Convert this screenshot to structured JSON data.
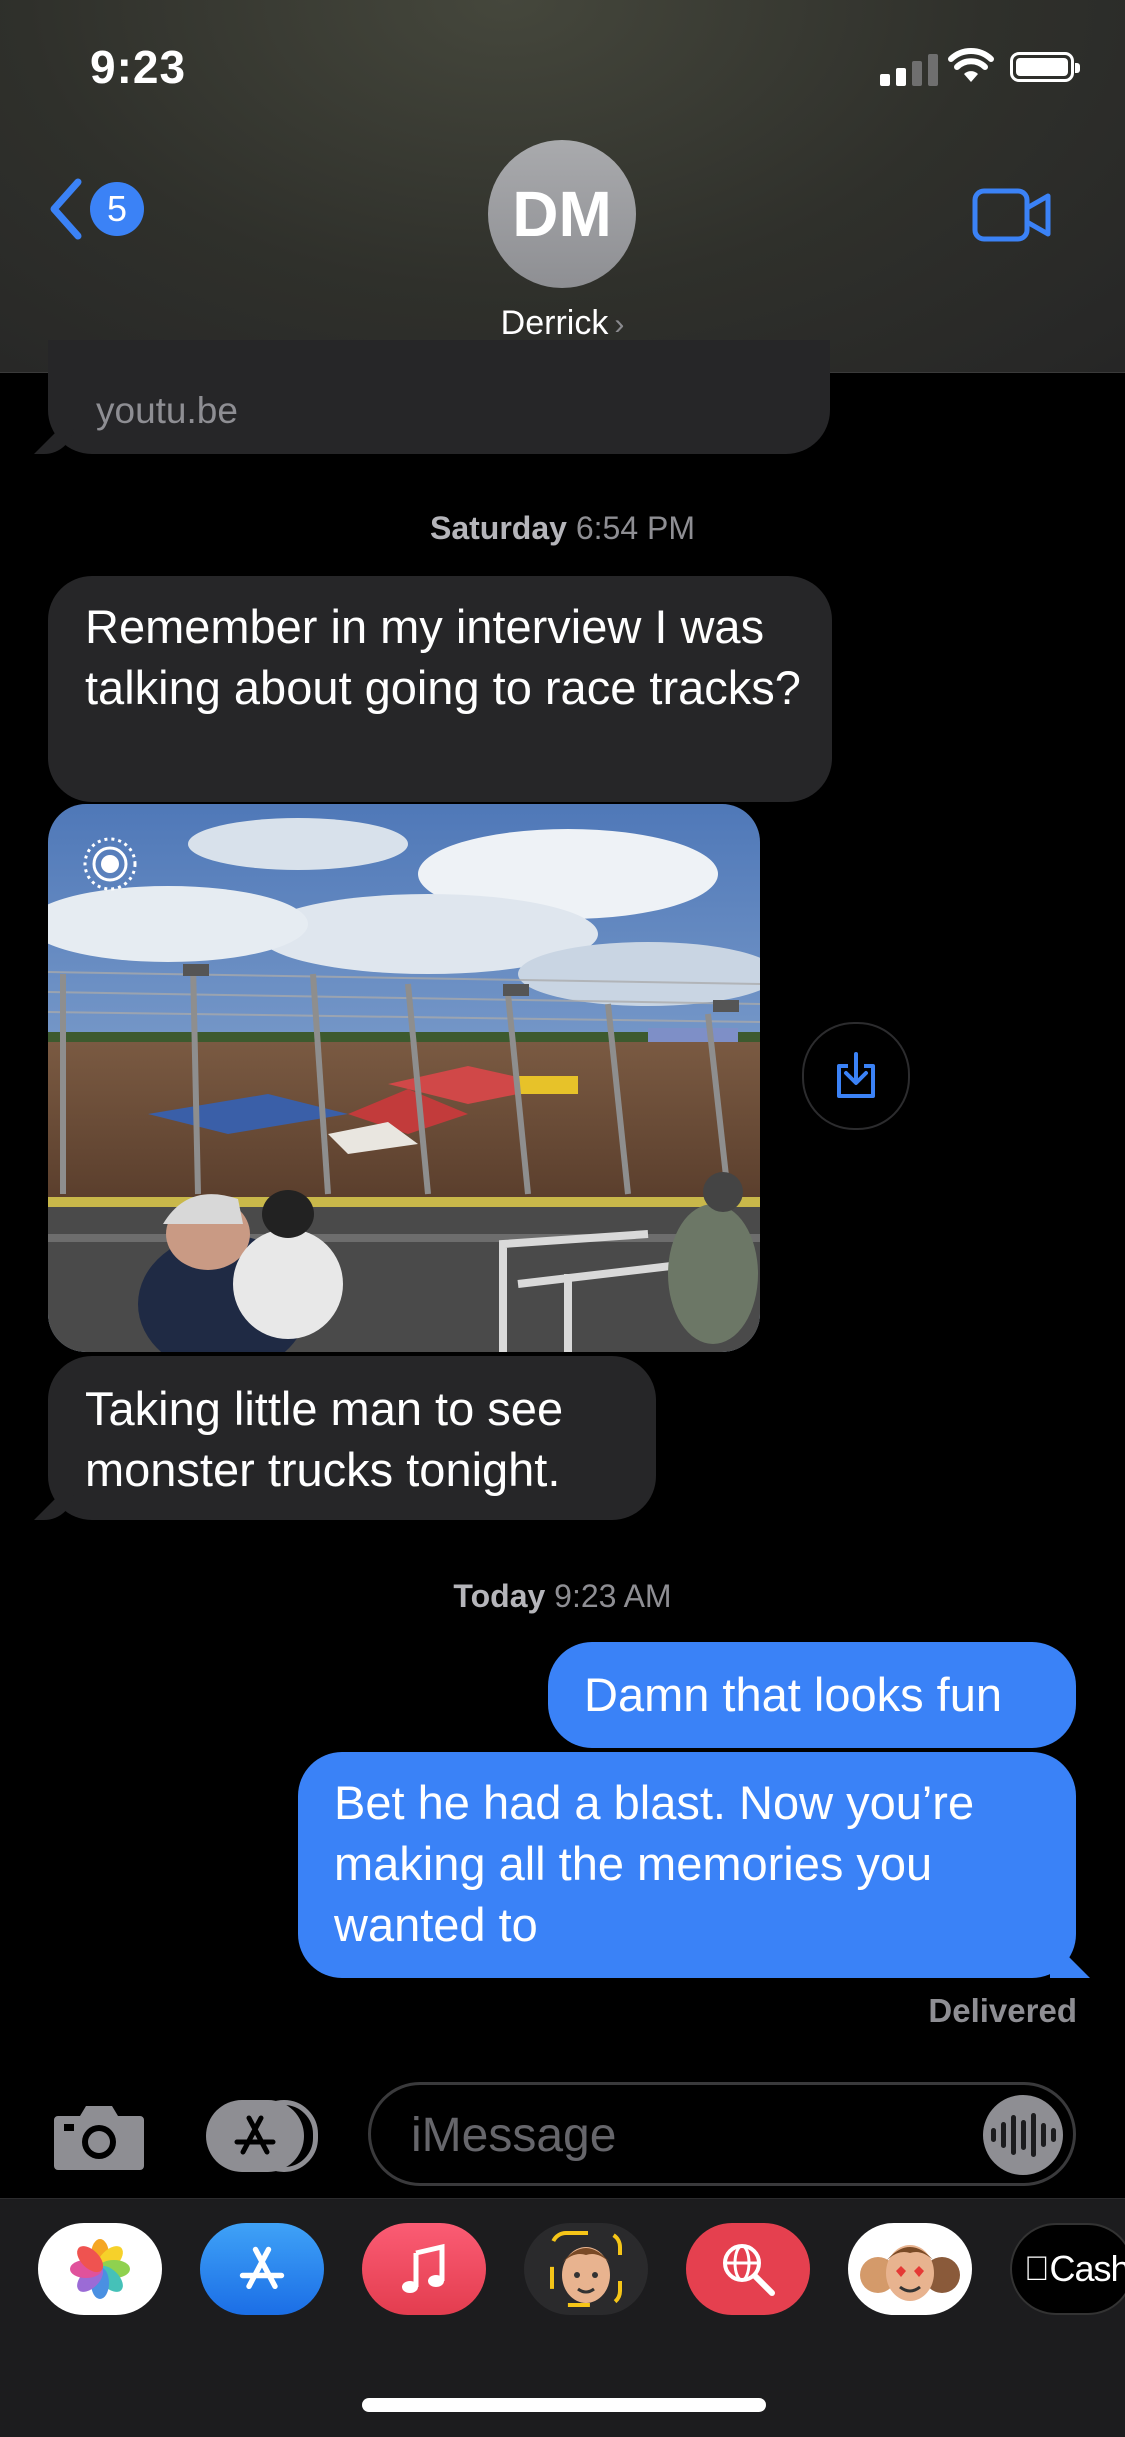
{
  "status_bar": {
    "time": "9:23"
  },
  "header": {
    "back_count": "5",
    "avatar_initials": "DM",
    "contact_name": "Derrick",
    "chevron": "›"
  },
  "messages": {
    "link_preview_domain": "youtu.be",
    "timestamp_1": {
      "day": "Saturday",
      "time": "6:54 PM"
    },
    "incoming_1": "Remember in my interview I was talking about going to race tracks?",
    "photo_alt": "Monster truck race track with spectators behind a fence",
    "incoming_2": "Taking little man to see monster trucks tonight.",
    "timestamp_2": {
      "day": "Today",
      "time": "9:23 AM"
    },
    "outgoing_1": "Damn that looks fun",
    "outgoing_2": "Bet he had a blast. Now you’re making all the memories you wanted to",
    "delivered": "Delivered"
  },
  "composer": {
    "placeholder": "iMessage"
  },
  "app_drawer": {
    "items": [
      {
        "name": "photos-app-icon"
      },
      {
        "name": "app-store-icon"
      },
      {
        "name": "music-app-icon"
      },
      {
        "name": "memoji-icon"
      },
      {
        "name": "images-search-icon"
      },
      {
        "name": "memoji-stickers-icon"
      },
      {
        "name": "apple-cash-icon",
        "label": "Cash"
      }
    ]
  },
  "colors": {
    "accent": "#3b82f6",
    "incoming_bubble": "#262628",
    "outgoing_bubble": "#3a82f7",
    "background": "#000000"
  }
}
